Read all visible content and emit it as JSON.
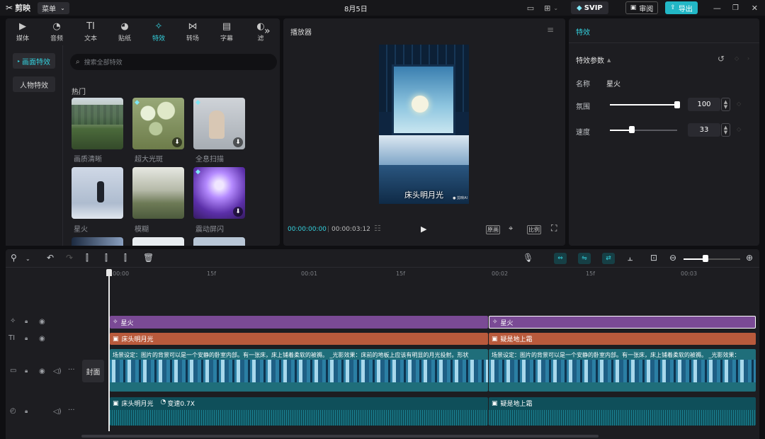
{
  "titlebar": {
    "app_name": "剪映",
    "menu_label": "菜单",
    "project_date": "8月5日",
    "svip_label": "SVIP",
    "review_label": "审阅",
    "export_label": "导出"
  },
  "media_tabs": [
    {
      "label": "媒体",
      "icon": "play-icon"
    },
    {
      "label": "音频",
      "icon": "audio-icon"
    },
    {
      "label": "文本",
      "icon": "text-icon"
    },
    {
      "label": "贴纸",
      "icon": "sticker-icon"
    },
    {
      "label": "特效",
      "icon": "sparkle-icon",
      "active": true
    },
    {
      "label": "转场",
      "icon": "transition-icon"
    },
    {
      "label": "字幕",
      "icon": "subtitle-icon"
    },
    {
      "label": "滤",
      "icon": "filter-icon"
    }
  ],
  "effects_sidebar": {
    "screen_effects": "画面特效",
    "person_effects": "人物特效"
  },
  "search": {
    "placeholder": "搜索全部特效"
  },
  "section_hot": "热门",
  "effect_items": [
    {
      "name": "画质清晰",
      "vip": false,
      "download": false
    },
    {
      "name": "超大光斑",
      "vip": true,
      "download": true
    },
    {
      "name": "全息扫描",
      "vip": true,
      "download": true
    },
    {
      "name": "星火",
      "vip": false,
      "download": false
    },
    {
      "name": "模糊",
      "vip": false,
      "download": false
    },
    {
      "name": "震动屏闪",
      "vip": true,
      "download": true
    }
  ],
  "player": {
    "title": "播放器",
    "caption": "床头明月光",
    "watermark": "● 剪映AI",
    "current_time": "00:00:00:00",
    "total_time": "00:00:03:12",
    "btn_original": "原画",
    "btn_ratio": "比例"
  },
  "inspector": {
    "tab": "特效",
    "section": "特效参数",
    "name_label": "名称",
    "name_value": "星火",
    "atmosphere_label": "氛围",
    "atmosphere_value": "100",
    "atmosphere_level": 1.0,
    "speed_label": "速度",
    "speed_value": "33",
    "speed_level": 0.33
  },
  "timeline": {
    "ruler": [
      "00:00",
      "15f",
      "00:01",
      "15f",
      "00:02",
      "15f",
      "00:03"
    ],
    "cover_label": "封面",
    "effect_clips": [
      "星火",
      "星火"
    ],
    "text_clips": [
      "床头明月光",
      "疑是地上霜"
    ],
    "video_clips": [
      "场景设定：图片的背景可以是一个安静的卧室内部。有一张床，床上铺着柔软的被褥。 _光影效果：床前的地板上应该有明显的月光投射。形状",
      "场景设定：图片的背景可以是一个安静的卧室内部。有一张床，床上铺着柔软的被褥。 _光影效果："
    ],
    "audio_clips": [
      "床头明月光",
      "疑是地上霜"
    ],
    "audio_speed_badge": "变速0.7X"
  },
  "colors": {
    "accent": "#22b7c6",
    "effect_track": "#7a4a95",
    "text_track": "#b95a3c",
    "video_track": "#1f6e7a",
    "audio_track": "#0f4f5a"
  }
}
